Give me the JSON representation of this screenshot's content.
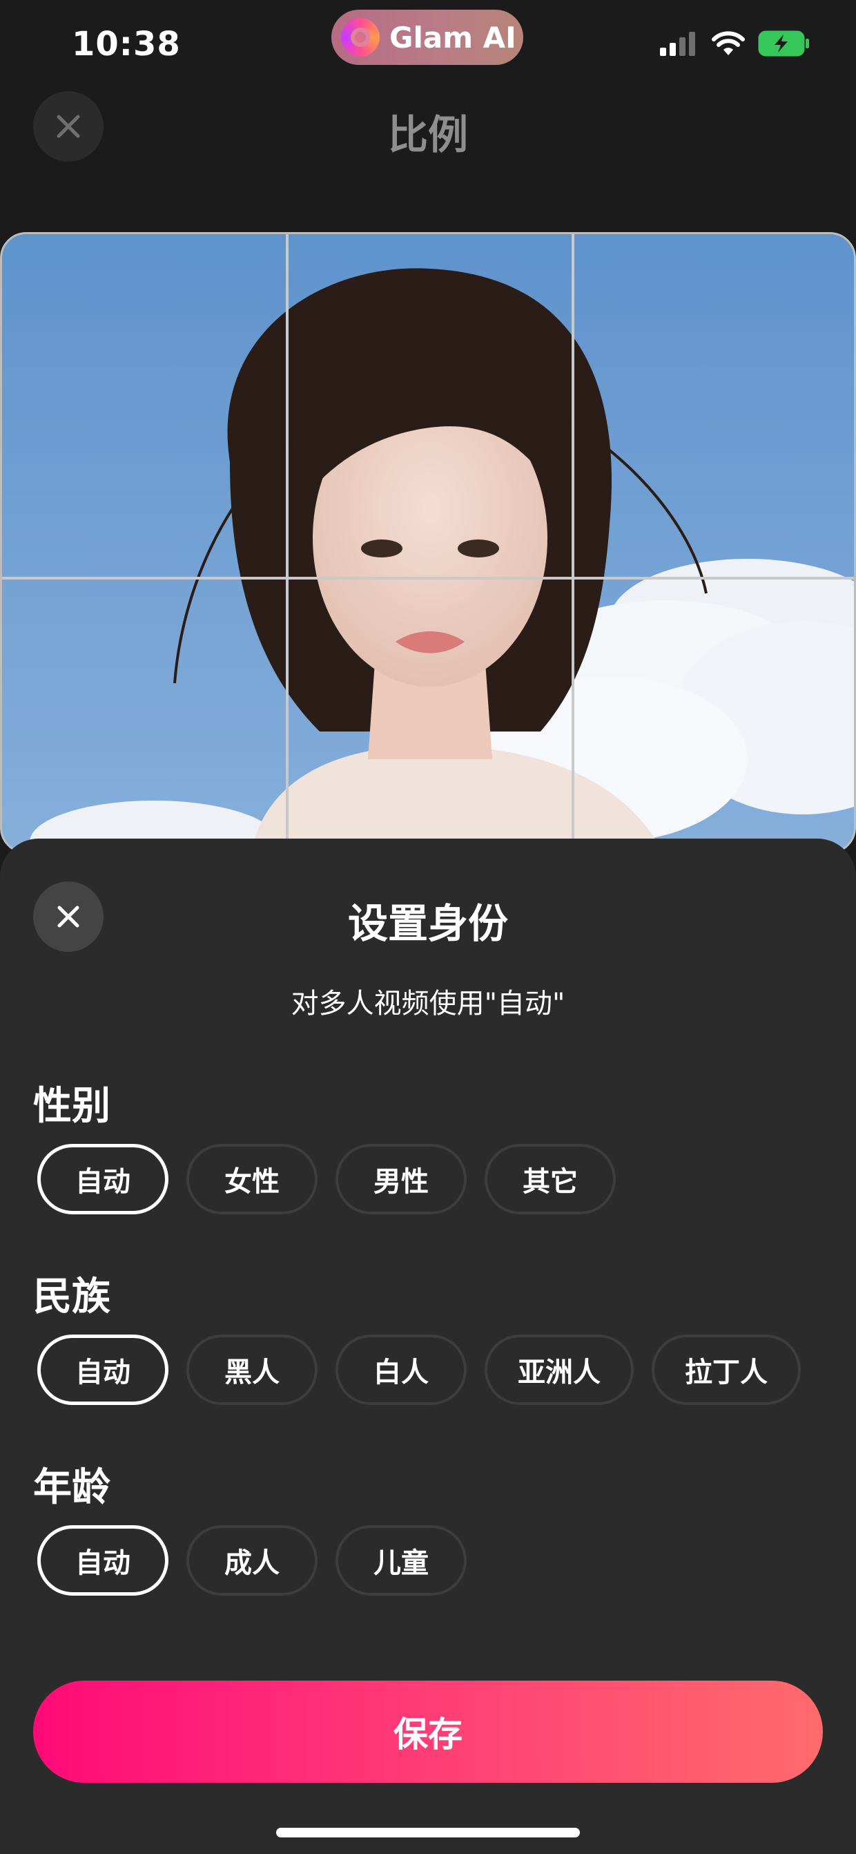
{
  "status_bar": {
    "time": "10:38",
    "app_name": "Glam AI",
    "icons": [
      "cellular-signal-icon",
      "wifi-icon",
      "battery-charging-icon"
    ]
  },
  "header": {
    "title": "比例",
    "close_icon": "close-icon"
  },
  "sheet": {
    "title": "设置身份",
    "subtitle": "对多人视频使用\"自动\"",
    "close_icon": "close-icon",
    "gender": {
      "label": "性别",
      "options": [
        "自动",
        "女性",
        "男性",
        "其它"
      ],
      "selected": "自动"
    },
    "ethnicity": {
      "label": "民族",
      "options": [
        "自动",
        "黑人",
        "白人",
        "亚洲人",
        "拉丁人"
      ],
      "selected": "自动"
    },
    "age": {
      "label": "年龄",
      "options": [
        "自动",
        "成人",
        "儿童"
      ],
      "selected": "自动"
    },
    "save_label": "保存"
  },
  "colors": {
    "background": "#1b1b1b",
    "sheet": "#2b2b2b",
    "accent_start": "#ff0a78",
    "accent_end": "#ff6b6b"
  }
}
